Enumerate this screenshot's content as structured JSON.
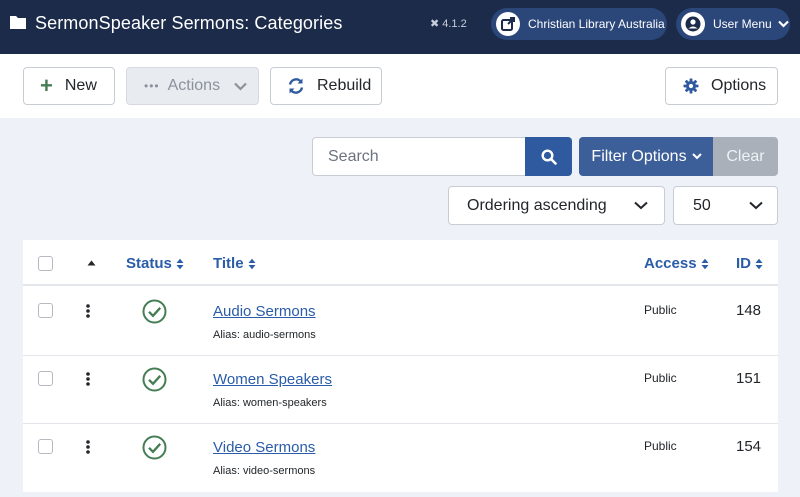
{
  "header": {
    "title": "SermonSpeaker Sermons: Categories",
    "version": "4.1.2",
    "site_link": "Christian Library Australia",
    "user_menu": "User Menu"
  },
  "toolbar": {
    "new_label": "New",
    "actions_label": "Actions",
    "rebuild_label": "Rebuild",
    "options_label": "Options"
  },
  "search": {
    "placeholder": "Search",
    "filter_options_label": "Filter Options",
    "clear_label": "Clear"
  },
  "list": {
    "ordering": "Ordering ascending",
    "limit": "50"
  },
  "table": {
    "columns": {
      "status": "Status",
      "title": "Title",
      "access": "Access",
      "id": "ID"
    },
    "rows": [
      {
        "title": "Audio Sermons",
        "alias": "Alias: audio-sermons",
        "access": "Public",
        "id": "148",
        "status": "published"
      },
      {
        "title": "Women Speakers",
        "alias": "Alias: women-speakers",
        "access": "Public",
        "id": "151",
        "status": "published"
      },
      {
        "title": "Video Sermons",
        "alias": "Alias: video-sermons",
        "access": "Public",
        "id": "154",
        "status": "published"
      }
    ]
  },
  "colors": {
    "header_bg": "#1b2b49",
    "link": "#2a5ca8",
    "published": "#457d54"
  }
}
